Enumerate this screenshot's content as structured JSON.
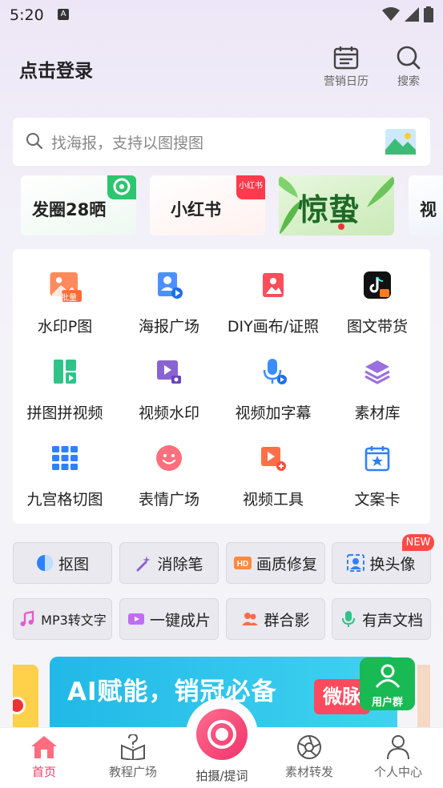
{
  "status_bar": {
    "time": "5:20"
  },
  "header": {
    "login": "点击登录",
    "calendar_label": "营销日历",
    "search_label": "搜索"
  },
  "search": {
    "placeholder": "找海报，支持以图搜图"
  },
  "banners": [
    {
      "label": "发圈28晒"
    },
    {
      "label": "小红书",
      "badge": "小红书"
    },
    {
      "label": "惊蛰"
    },
    {
      "label": "视"
    }
  ],
  "grid": [
    {
      "label": "水印P图",
      "badge": "批量",
      "icon": "watermark-image-icon"
    },
    {
      "label": "海报广场",
      "icon": "poster-icon"
    },
    {
      "label": "DIY画布/证照",
      "icon": "canvas-icon"
    },
    {
      "label": "图文带货",
      "icon": "tiktok-cart-icon"
    },
    {
      "label": "拼图拼视频",
      "icon": "collage-icon"
    },
    {
      "label": "视频水印",
      "icon": "video-watermark-icon"
    },
    {
      "label": "视频加字幕",
      "icon": "subtitle-mic-icon"
    },
    {
      "label": "素材库",
      "icon": "layers-icon"
    },
    {
      "label": "九宫格切图",
      "icon": "grid-icon"
    },
    {
      "label": "表情广场",
      "icon": "emoji-icon"
    },
    {
      "label": "视频工具",
      "icon": "video-tool-icon"
    },
    {
      "label": "文案卡",
      "icon": "copy-card-icon"
    }
  ],
  "tools_row1": [
    {
      "label": "抠图",
      "icon": "cutout-icon"
    },
    {
      "label": "消除笔",
      "icon": "magic-wand-icon"
    },
    {
      "label": "画质修复",
      "icon": "hd-icon"
    },
    {
      "label": "换头像",
      "icon": "face-swap-icon"
    }
  ],
  "new_badge": "NEW",
  "tools_row2": [
    {
      "label": "MP3转文字",
      "icon": "music-note-icon"
    },
    {
      "label": "一键成片",
      "icon": "video-clip-icon"
    },
    {
      "label": "群合影",
      "icon": "group-icon"
    },
    {
      "label": "有声文档",
      "icon": "microphone-icon"
    }
  ],
  "promo": {
    "headline": "AI赋能，销冠必备",
    "brand": "微脉",
    "user_group": "用户群"
  },
  "nav": [
    {
      "label": "首页",
      "active": true
    },
    {
      "label": "教程广场"
    },
    {
      "label": "拍摄/提词"
    },
    {
      "label": "素材转发"
    },
    {
      "label": "个人中心"
    }
  ],
  "colors": {
    "accent": "#f33a66",
    "badge_red": "#ff4a44",
    "icon_orange": "#ff7048",
    "icon_blue": "#3b8cff",
    "icon_green": "#34c285",
    "icon_purple": "#8a63d2"
  }
}
